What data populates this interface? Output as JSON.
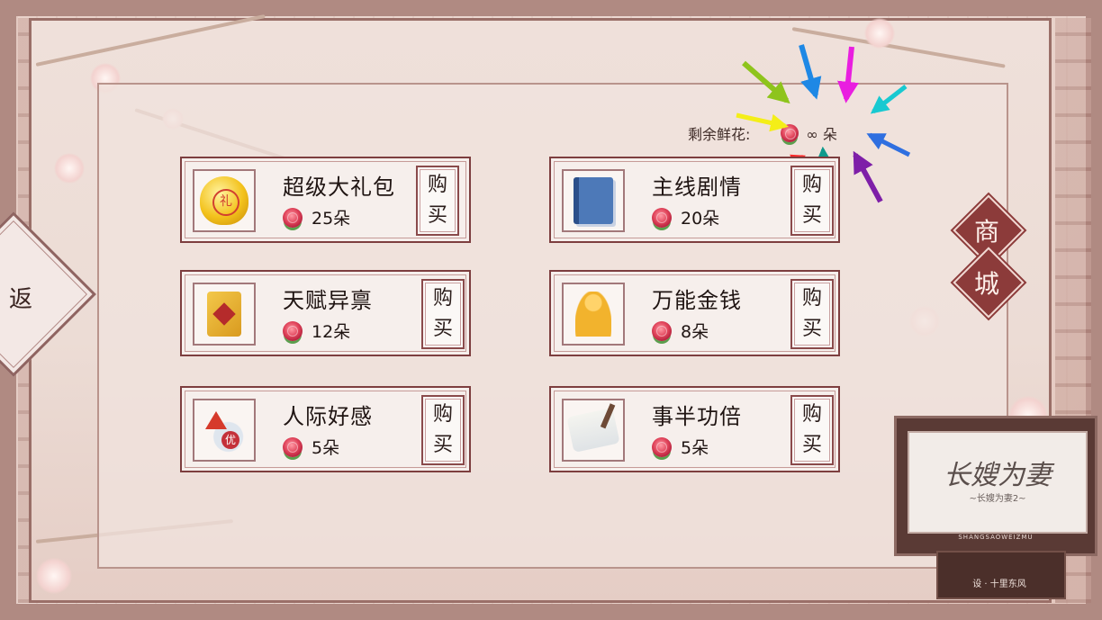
{
  "header": {
    "remaining_label": "剩余鲜花:",
    "remaining_value": "∞ 朵"
  },
  "nav": {
    "back_label": "返",
    "shop_chars": [
      "商",
      "城"
    ]
  },
  "items": [
    {
      "title": "超级大礼包",
      "price": "25朵",
      "buy_top": "购",
      "buy_bottom": "买",
      "icon": "gift-bag-icon"
    },
    {
      "title": "主线剧情",
      "price": "20朵",
      "buy_top": "购",
      "buy_bottom": "买",
      "icon": "story-book-icon"
    },
    {
      "title": "天赋异禀",
      "price": "12朵",
      "buy_top": "购",
      "buy_bottom": "买",
      "icon": "talent-card-icon"
    },
    {
      "title": "万能金钱",
      "price": "8朵",
      "buy_top": "购",
      "buy_bottom": "买",
      "icon": "gold-statue-icon"
    },
    {
      "title": "人际好感",
      "price": "5朵",
      "buy_top": "购",
      "buy_bottom": "买",
      "icon": "favor-potion-icon"
    },
    {
      "title": "事半功倍",
      "price": "5朵",
      "buy_top": "购",
      "buy_bottom": "买",
      "icon": "scroll-icon"
    }
  ],
  "logo": {
    "script": "长嫂为妻",
    "subtitle": "~长嫂为妻2~",
    "english": "SHANGSAOWEIZMU",
    "label": "设 · 十里东风"
  },
  "colors": {
    "card_border": "#7d3e3f",
    "shop_tab": "#8c3b3a",
    "arrows": [
      "#ff2a2a",
      "#8ec41c",
      "#1e88e5",
      "#e91ee0",
      "#18c9d1",
      "#f4ee18",
      "#2f6fe0",
      "#7e1fa8",
      "#0f9a8c"
    ]
  }
}
